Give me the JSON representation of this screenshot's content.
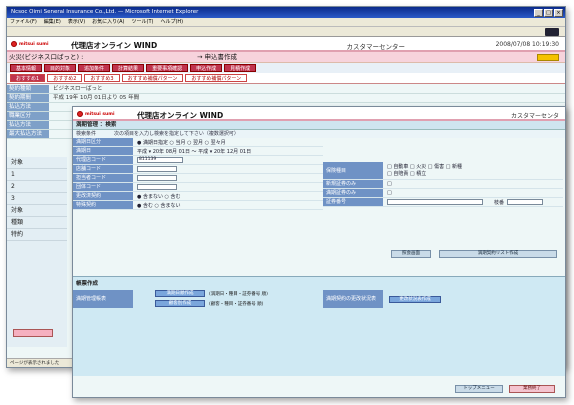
{
  "back": {
    "title": "Ncsoc Oimi Seneral Insurance Co.,Ltd. — Microsoft Internet Explorer",
    "menu": [
      "ファイル(F)",
      "編集(E)",
      "表示(V)",
      "お気に入り(A)",
      "ツール(T)",
      "ヘルプ(H)"
    ],
    "app_name": "代理店オンライン WIND",
    "logo_text": "mitsui sumi",
    "center_label": "カスタマーセンター",
    "datetime": "2008/07/08 10:19:30",
    "pink_text": "火災(ビジネス口ばっと) :",
    "pink_arrow": "→ 申込書作成",
    "tabs": [
      "基本情報",
      "目的対象",
      "追加条件",
      "計算結果",
      "重要事項確認",
      "申込作成",
      "見積作成"
    ],
    "subtabs": [
      "おすすめ1",
      "おすすめ2",
      "おすすめ3",
      "おすすめ補償パターン",
      "おすすめ補償パターン"
    ],
    "rows": [
      {
        "label": "契約種類",
        "value": "ビジネスロ一ばっと"
      },
      {
        "label": "契約期間",
        "value": "平成 19年 10月 01日より  05 年間"
      },
      {
        "label": "払込方法",
        "value": ""
      },
      {
        "label": "職業区分",
        "value": ""
      },
      {
        "label": "払込方法",
        "value": ""
      },
      {
        "label": "最大払込方法",
        "value": ""
      }
    ],
    "side": [
      "対象",
      "1",
      "2",
      "3",
      "対象",
      "種類",
      "特約"
    ],
    "status": "ページが表示されました"
  },
  "front": {
    "app_name": "代理店オンライン WIND",
    "logo_text": "mitsui sumi",
    "center_label": "カスタマーセンタ",
    "section": "満期管理 ：検索",
    "instr": [
      "検索条件",
      "次の項目を入力し検索を指定して下さい（複数選択可）"
    ],
    "left_rows": [
      {
        "label": "満期日区分",
        "value": "● 満期日指定  ○ 当月  ○ 翌月  ○ 翌々月"
      },
      {
        "label": "満期日",
        "value": "平成 ▾ 20年 08月 01日 〜 平成 ▾ 20年 12月 01日"
      },
      {
        "label": "代理店コード",
        "value": ""
      },
      {
        "label": "店舗コード",
        "value": ""
      },
      {
        "label": "担当者コード",
        "value": ""
      },
      {
        "label": "団体コード",
        "value": ""
      },
      {
        "label": "更改済契約",
        "value": "● 含まない  ○ 含む"
      },
      {
        "label": "特殊契約",
        "value": "● 含む  ○ 含まない"
      }
    ],
    "agency_code": "811139",
    "right_rows": [
      {
        "label": "保険種目",
        "value": "□ 自動車  □ 火災  □ 傷害  □ 新種\n□ 自賠責  □ 積立"
      },
      {
        "label": "新規証券のみ",
        "value": "□"
      },
      {
        "label": "満期証券のみ",
        "value": "□"
      },
      {
        "label": "証券番号",
        "value": ""
      }
    ],
    "seq_label": "枝番",
    "search_btn": "照会画面",
    "search_btn2": "満期契約リスト作成",
    "lower_title": "帳票作成",
    "lower_label1": "満期管理帳表",
    "lower_btn1": "満期日順作成",
    "lower_btn2": "顧客別作成",
    "lower_note1": "(満期日・種目・証券番号 順)",
    "lower_note2": "(顧客・種目・証券番号 順)",
    "lower_label2": "満期契約の更改状況表",
    "lower_btn3": "更改状況表作成",
    "bottom_btn1": "トップメニュー",
    "bottom_btn2": "業務終了"
  }
}
